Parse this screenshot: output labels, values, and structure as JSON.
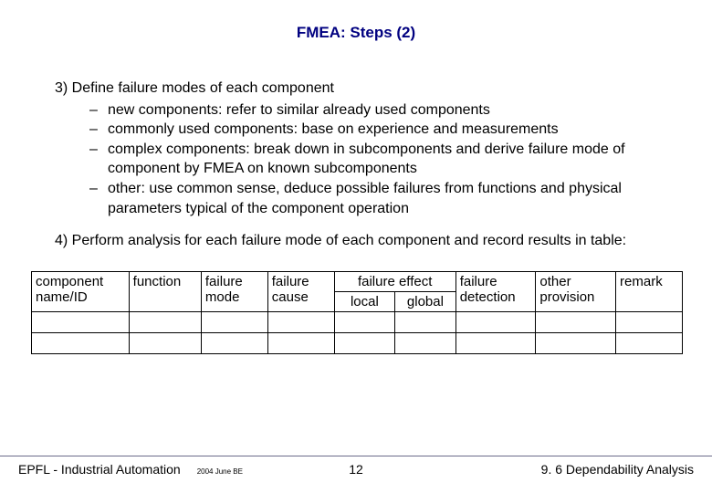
{
  "title": "FMEA: Steps (2)",
  "step3": {
    "heading": "3) Define failure modes of each component",
    "bullets": [
      "new components: refer to similar already used components",
      "commonly used components: base on experience and measurements",
      "complex components: break down in subcomponents and derive failure mode of component by FMEA on known subcomponents",
      "other: use common sense, deduce possible failures from functions and physical parameters typical of the component operation"
    ]
  },
  "step4": {
    "heading": "4) Perform analysis for each failure mode of each component and record results in table:"
  },
  "table": {
    "headers": {
      "component": "component name/ID",
      "function": "function",
      "failure_mode": "failure mode",
      "failure_cause": "failure cause",
      "failure_effect": "failure effect",
      "local": "local",
      "global": "global",
      "detection": "failure detection",
      "provision": "other provision",
      "remark": "remark"
    }
  },
  "footer": {
    "left": "EPFL - Industrial Automation",
    "date": "2004 June BE",
    "page": "12",
    "right": "9. 6 Dependability Analysis"
  },
  "dash": "–"
}
